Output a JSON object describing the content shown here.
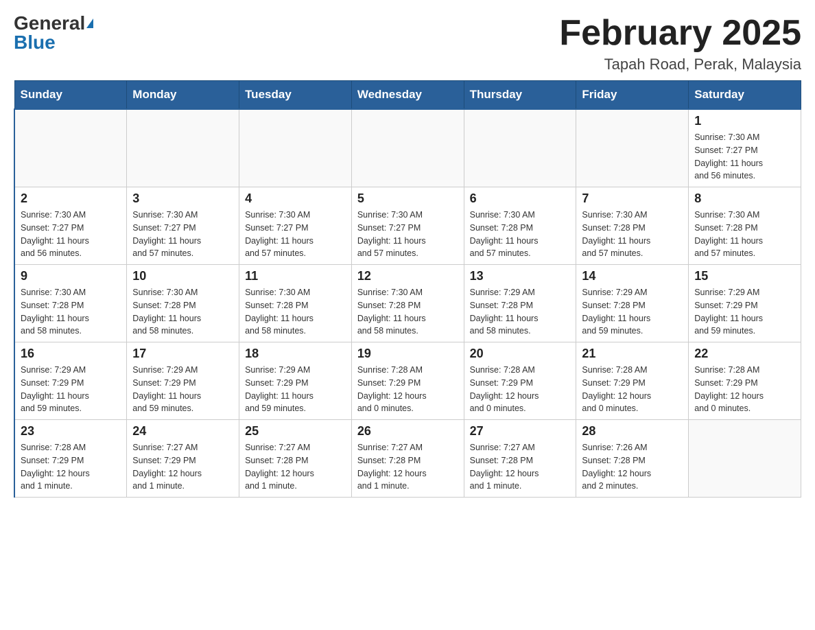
{
  "header": {
    "logo_general": "General",
    "logo_blue": "Blue",
    "title": "February 2025",
    "subtitle": "Tapah Road, Perak, Malaysia"
  },
  "weekdays": [
    "Sunday",
    "Monday",
    "Tuesday",
    "Wednesday",
    "Thursday",
    "Friday",
    "Saturday"
  ],
  "weeks": [
    [
      {
        "day": "",
        "info": ""
      },
      {
        "day": "",
        "info": ""
      },
      {
        "day": "",
        "info": ""
      },
      {
        "day": "",
        "info": ""
      },
      {
        "day": "",
        "info": ""
      },
      {
        "day": "",
        "info": ""
      },
      {
        "day": "1",
        "info": "Sunrise: 7:30 AM\nSunset: 7:27 PM\nDaylight: 11 hours\nand 56 minutes."
      }
    ],
    [
      {
        "day": "2",
        "info": "Sunrise: 7:30 AM\nSunset: 7:27 PM\nDaylight: 11 hours\nand 56 minutes."
      },
      {
        "day": "3",
        "info": "Sunrise: 7:30 AM\nSunset: 7:27 PM\nDaylight: 11 hours\nand 57 minutes."
      },
      {
        "day": "4",
        "info": "Sunrise: 7:30 AM\nSunset: 7:27 PM\nDaylight: 11 hours\nand 57 minutes."
      },
      {
        "day": "5",
        "info": "Sunrise: 7:30 AM\nSunset: 7:27 PM\nDaylight: 11 hours\nand 57 minutes."
      },
      {
        "day": "6",
        "info": "Sunrise: 7:30 AM\nSunset: 7:28 PM\nDaylight: 11 hours\nand 57 minutes."
      },
      {
        "day": "7",
        "info": "Sunrise: 7:30 AM\nSunset: 7:28 PM\nDaylight: 11 hours\nand 57 minutes."
      },
      {
        "day": "8",
        "info": "Sunrise: 7:30 AM\nSunset: 7:28 PM\nDaylight: 11 hours\nand 57 minutes."
      }
    ],
    [
      {
        "day": "9",
        "info": "Sunrise: 7:30 AM\nSunset: 7:28 PM\nDaylight: 11 hours\nand 58 minutes."
      },
      {
        "day": "10",
        "info": "Sunrise: 7:30 AM\nSunset: 7:28 PM\nDaylight: 11 hours\nand 58 minutes."
      },
      {
        "day": "11",
        "info": "Sunrise: 7:30 AM\nSunset: 7:28 PM\nDaylight: 11 hours\nand 58 minutes."
      },
      {
        "day": "12",
        "info": "Sunrise: 7:30 AM\nSunset: 7:28 PM\nDaylight: 11 hours\nand 58 minutes."
      },
      {
        "day": "13",
        "info": "Sunrise: 7:29 AM\nSunset: 7:28 PM\nDaylight: 11 hours\nand 58 minutes."
      },
      {
        "day": "14",
        "info": "Sunrise: 7:29 AM\nSunset: 7:28 PM\nDaylight: 11 hours\nand 59 minutes."
      },
      {
        "day": "15",
        "info": "Sunrise: 7:29 AM\nSunset: 7:29 PM\nDaylight: 11 hours\nand 59 minutes."
      }
    ],
    [
      {
        "day": "16",
        "info": "Sunrise: 7:29 AM\nSunset: 7:29 PM\nDaylight: 11 hours\nand 59 minutes."
      },
      {
        "day": "17",
        "info": "Sunrise: 7:29 AM\nSunset: 7:29 PM\nDaylight: 11 hours\nand 59 minutes."
      },
      {
        "day": "18",
        "info": "Sunrise: 7:29 AM\nSunset: 7:29 PM\nDaylight: 11 hours\nand 59 minutes."
      },
      {
        "day": "19",
        "info": "Sunrise: 7:28 AM\nSunset: 7:29 PM\nDaylight: 12 hours\nand 0 minutes."
      },
      {
        "day": "20",
        "info": "Sunrise: 7:28 AM\nSunset: 7:29 PM\nDaylight: 12 hours\nand 0 minutes."
      },
      {
        "day": "21",
        "info": "Sunrise: 7:28 AM\nSunset: 7:29 PM\nDaylight: 12 hours\nand 0 minutes."
      },
      {
        "day": "22",
        "info": "Sunrise: 7:28 AM\nSunset: 7:29 PM\nDaylight: 12 hours\nand 0 minutes."
      }
    ],
    [
      {
        "day": "23",
        "info": "Sunrise: 7:28 AM\nSunset: 7:29 PM\nDaylight: 12 hours\nand 1 minute."
      },
      {
        "day": "24",
        "info": "Sunrise: 7:27 AM\nSunset: 7:29 PM\nDaylight: 12 hours\nand 1 minute."
      },
      {
        "day": "25",
        "info": "Sunrise: 7:27 AM\nSunset: 7:28 PM\nDaylight: 12 hours\nand 1 minute."
      },
      {
        "day": "26",
        "info": "Sunrise: 7:27 AM\nSunset: 7:28 PM\nDaylight: 12 hours\nand 1 minute."
      },
      {
        "day": "27",
        "info": "Sunrise: 7:27 AM\nSunset: 7:28 PM\nDaylight: 12 hours\nand 1 minute."
      },
      {
        "day": "28",
        "info": "Sunrise: 7:26 AM\nSunset: 7:28 PM\nDaylight: 12 hours\nand 2 minutes."
      },
      {
        "day": "",
        "info": ""
      }
    ]
  ]
}
